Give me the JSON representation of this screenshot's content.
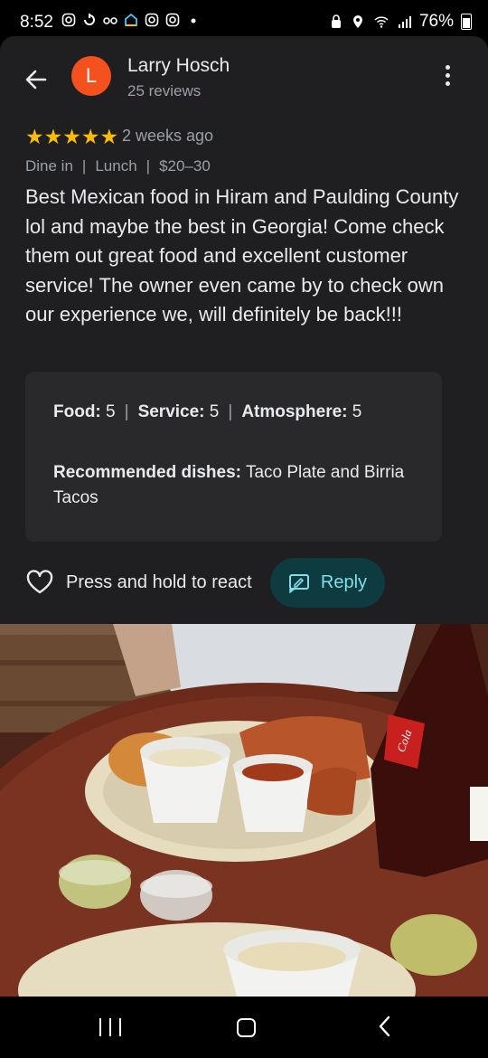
{
  "status_bar": {
    "time": "8:52",
    "battery": "76%",
    "left_icons": [
      "instagram-icon",
      "sync-icon",
      "glasses-icon",
      "google-home-icon",
      "instagram-icon",
      "instagram-icon",
      "dot-icon"
    ],
    "right_icons": [
      "lock-icon",
      "location-icon",
      "wifi-icon",
      "signal-icon",
      "battery-icon"
    ]
  },
  "reviewer": {
    "avatar_letter": "L",
    "name": "Larry Hosch",
    "reviews": "25 reviews",
    "avatar_color": "#f4511e"
  },
  "review": {
    "stars": "★★★★★",
    "rating": 5,
    "time_ago": "2 weeks ago",
    "tags": [
      "Dine in",
      "Lunch",
      "$20–30"
    ],
    "tag_separator": "|",
    "text": "Best Mexican food in Hiram and  Paulding County lol and maybe the best in Georgia! Come check them out great food and excellent customer service! The owner even came by to check own our experience we, will definitely be back!!!"
  },
  "ratings": {
    "separator": "|",
    "food_label": "Food:",
    "food_value": "5",
    "service_label": "Service:",
    "service_value": "5",
    "atmosphere_label": "Atmosphere:",
    "atmosphere_value": "5",
    "recommended_label": "Recommended dishes:",
    "recommended_value": "Taco Plate and Birria Tacos"
  },
  "actions": {
    "react_label": "Press and hold to react",
    "reply_label": "Reply"
  },
  "photo": {
    "label": "Cola"
  },
  "colors": {
    "background": "#1f1f21",
    "card": "#29292b",
    "star": "#fbbc04",
    "reply_bg": "#0d3b40",
    "reply_text": "#80deea",
    "text_primary": "#e8eaed",
    "text_secondary": "#9aa0a6"
  }
}
